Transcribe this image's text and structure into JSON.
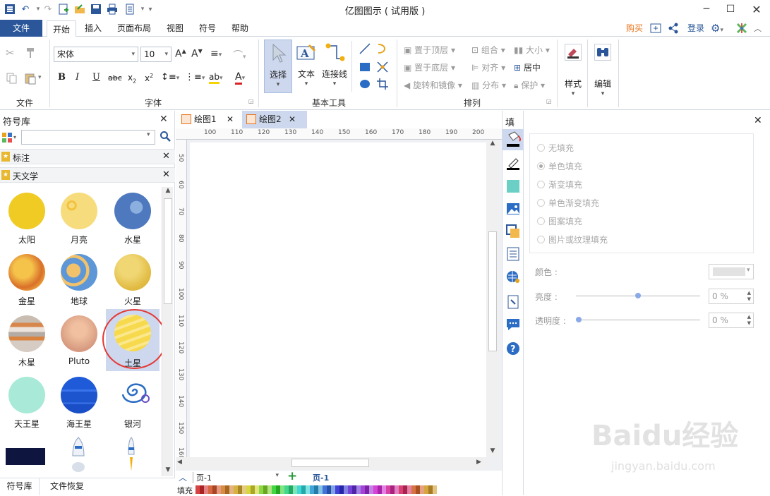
{
  "window": {
    "title": "亿图图示 ( 试用版 )"
  },
  "menu": {
    "file": "文件",
    "items": [
      "开始",
      "插入",
      "页面布局",
      "视图",
      "符号",
      "帮助"
    ],
    "buy": "购买",
    "login": "登录"
  },
  "ribbon": {
    "groups": {
      "file": "文件",
      "font": "字体",
      "basic_tools": "基本工具",
      "arrange": "排列"
    },
    "font_name": "宋体",
    "font_size": "10",
    "tools": {
      "select": "选择",
      "text": "文本",
      "connector": "连接线"
    },
    "arrange": {
      "bring_front": "置于顶层",
      "send_back": "置于底层",
      "rotate": "旋转和镜像",
      "group": "组合",
      "align": "对齐",
      "distribute": "分布",
      "size": "大小",
      "center": "居中",
      "protect": "保护"
    },
    "style": "样式",
    "edit": "编辑"
  },
  "library": {
    "title": "符号库",
    "search_placeholder": "",
    "sections": [
      "标注",
      "天文学"
    ],
    "shapes": [
      "太阳",
      "月亮",
      "水星",
      "金星",
      "地球",
      "火星",
      "木星",
      "Pluto",
      "土星",
      "天王星",
      "海王星",
      "银河"
    ],
    "bottom_tabs": [
      "符号库",
      "文件恢复"
    ]
  },
  "doc_tabs": [
    "绘图1",
    "绘图2"
  ],
  "ruler": {
    "h": [
      "100",
      "110",
      "120",
      "130",
      "140",
      "150",
      "160",
      "170",
      "180",
      "190",
      "200"
    ],
    "v": [
      "50",
      "60",
      "70",
      "80",
      "90",
      "100",
      "110",
      "120",
      "130",
      "140",
      "150",
      "160"
    ]
  },
  "pages": {
    "selector": "页-1",
    "current": "页-1"
  },
  "fill_label": "填充",
  "fill_panel": {
    "title": "填充",
    "options": [
      "无填充",
      "单色填充",
      "渐变填充",
      "单色渐变填充",
      "图案填充",
      "图片或纹理填充"
    ],
    "selected_index": 1,
    "color_label": "颜色 :",
    "brightness_label": "亮度 :",
    "brightness_value": "0 %",
    "transparency_label": "透明度 :",
    "transparency_value": "0 %"
  },
  "watermark": {
    "main": "Baidu经验",
    "url": "jingyan.baidu.com"
  },
  "colors": {
    "accent": "#2b579a",
    "buy": "#e8741c",
    "selection": "#cdd8ee",
    "highlight_circle": "#e53935"
  }
}
